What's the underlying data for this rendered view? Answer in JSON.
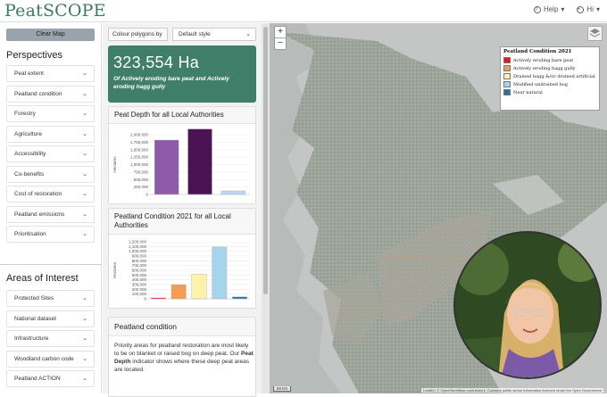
{
  "header": {
    "brand": "PeatSCOPE",
    "help_label": "Help",
    "user_label": "Hi"
  },
  "sidebar": {
    "clear_label": "Clear Map",
    "perspectives_title": "Perspectives",
    "perspectives": [
      "Peat extent",
      "Peatland condition",
      "Forestry",
      "Agriculture",
      "Accessibility",
      "Co-benefits",
      "Cost of restoration",
      "Peatland emissions",
      "Prioritisation"
    ],
    "areas_title": "Areas of Interest",
    "areas": [
      "Protected Sites",
      "National dataset",
      "Infrastructure",
      "Woodland carbon code",
      "Peatland ACTION"
    ]
  },
  "middle": {
    "colour_label": "Colour polygons by",
    "colour_value": "Default style",
    "stat_value": "323,554 Ha",
    "stat_desc": "Of Actively eroding bare peat and Actively eroding hagg gully",
    "depth_title": "Peat Depth for all Local Authorities",
    "condition_title": "Peatland Condition 2021 for all Local Authorities",
    "info_title": "Peatland condition",
    "info_text_1": "Priority areas for peatland restoration are most likely to be on blanket or raised bog on deep peat. Our ",
    "info_bold": "Peat Depth",
    "info_text_2": " indicator shows where these deep peat areas are located."
  },
  "chart_data": [
    {
      "type": "bar",
      "title": "Peat Depth for all Local Authorities",
      "ylabel": "Hectares",
      "ylim": [
        0,
        2000000
      ],
      "yticks": [
        "0",
        "250,000",
        "500,000",
        "750,000",
        "1,000,000",
        "1,250,000",
        "1,500,000",
        "1,750,000",
        "2,000,000"
      ],
      "values": [
        1820000,
        2190000,
        120000
      ],
      "colors": [
        "#8e5bab",
        "#4a1354",
        "#bcd6ee"
      ]
    },
    {
      "type": "bar",
      "title": "Peatland Condition 2021 for all Local Authorities",
      "ylabel": "Hectares",
      "ylim": [
        0,
        1200000
      ],
      "yticks": [
        "0",
        "100,000",
        "200,000",
        "300,000",
        "400,000",
        "500,000",
        "600,000",
        "700,000",
        "800,000",
        "900,000",
        "1,000,000",
        "1,100,000",
        "1,200,000"
      ],
      "values": [
        20000,
        300000,
        520000,
        1090000,
        40000
      ],
      "colors": [
        "#e31a1c",
        "#f39c52",
        "#fdf3a8",
        "#a6d4ea",
        "#2c6ea3"
      ]
    }
  ],
  "map": {
    "legend_title": "Peatland Condition 2021",
    "legend": [
      {
        "label": "Actively eroding bare peat",
        "color": "#e31a1c"
      },
      {
        "label": "Actively eroding hagg gully",
        "color": "#f39c52"
      },
      {
        "label": "Drained hagg &/or drained artificial",
        "color": "#fdf3a8"
      },
      {
        "label": "Modified undrained bog",
        "color": "#a6d4ea"
      },
      {
        "label": "Near natural",
        "color": "#2c6ea3"
      }
    ],
    "zoom_in": "+",
    "zoom_out": "−",
    "scale": "50 km",
    "attribution": "Leaflet | © OpenStreetMap contributors, Contains public sector information licensed under the Open Government"
  }
}
